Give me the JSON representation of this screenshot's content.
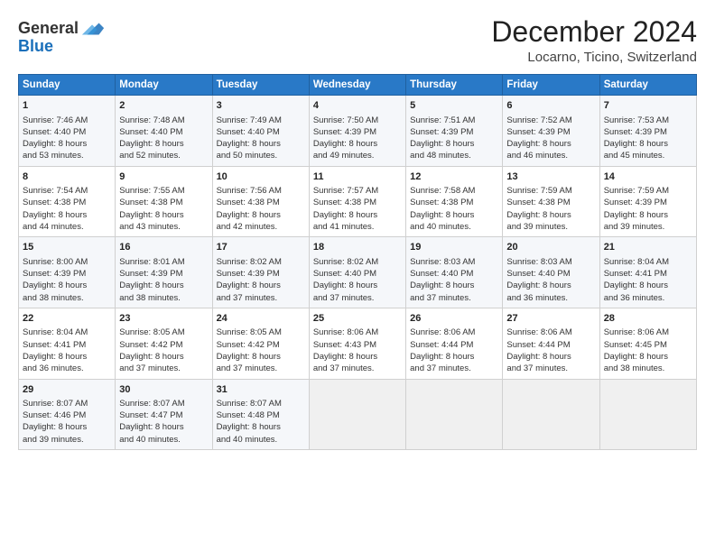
{
  "logo": {
    "line1": "General",
    "line2": "Blue"
  },
  "title": "December 2024",
  "location": "Locarno, Ticino, Switzerland",
  "days_of_week": [
    "Sunday",
    "Monday",
    "Tuesday",
    "Wednesday",
    "Thursday",
    "Friday",
    "Saturday"
  ],
  "weeks": [
    [
      {
        "day": "1",
        "lines": [
          "Sunrise: 7:46 AM",
          "Sunset: 4:40 PM",
          "Daylight: 8 hours",
          "and 53 minutes."
        ]
      },
      {
        "day": "2",
        "lines": [
          "Sunrise: 7:48 AM",
          "Sunset: 4:40 PM",
          "Daylight: 8 hours",
          "and 52 minutes."
        ]
      },
      {
        "day": "3",
        "lines": [
          "Sunrise: 7:49 AM",
          "Sunset: 4:40 PM",
          "Daylight: 8 hours",
          "and 50 minutes."
        ]
      },
      {
        "day": "4",
        "lines": [
          "Sunrise: 7:50 AM",
          "Sunset: 4:39 PM",
          "Daylight: 8 hours",
          "and 49 minutes."
        ]
      },
      {
        "day": "5",
        "lines": [
          "Sunrise: 7:51 AM",
          "Sunset: 4:39 PM",
          "Daylight: 8 hours",
          "and 48 minutes."
        ]
      },
      {
        "day": "6",
        "lines": [
          "Sunrise: 7:52 AM",
          "Sunset: 4:39 PM",
          "Daylight: 8 hours",
          "and 46 minutes."
        ]
      },
      {
        "day": "7",
        "lines": [
          "Sunrise: 7:53 AM",
          "Sunset: 4:39 PM",
          "Daylight: 8 hours",
          "and 45 minutes."
        ]
      }
    ],
    [
      {
        "day": "8",
        "lines": [
          "Sunrise: 7:54 AM",
          "Sunset: 4:38 PM",
          "Daylight: 8 hours",
          "and 44 minutes."
        ]
      },
      {
        "day": "9",
        "lines": [
          "Sunrise: 7:55 AM",
          "Sunset: 4:38 PM",
          "Daylight: 8 hours",
          "and 43 minutes."
        ]
      },
      {
        "day": "10",
        "lines": [
          "Sunrise: 7:56 AM",
          "Sunset: 4:38 PM",
          "Daylight: 8 hours",
          "and 42 minutes."
        ]
      },
      {
        "day": "11",
        "lines": [
          "Sunrise: 7:57 AM",
          "Sunset: 4:38 PM",
          "Daylight: 8 hours",
          "and 41 minutes."
        ]
      },
      {
        "day": "12",
        "lines": [
          "Sunrise: 7:58 AM",
          "Sunset: 4:38 PM",
          "Daylight: 8 hours",
          "and 40 minutes."
        ]
      },
      {
        "day": "13",
        "lines": [
          "Sunrise: 7:59 AM",
          "Sunset: 4:38 PM",
          "Daylight: 8 hours",
          "and 39 minutes."
        ]
      },
      {
        "day": "14",
        "lines": [
          "Sunrise: 7:59 AM",
          "Sunset: 4:39 PM",
          "Daylight: 8 hours",
          "and 39 minutes."
        ]
      }
    ],
    [
      {
        "day": "15",
        "lines": [
          "Sunrise: 8:00 AM",
          "Sunset: 4:39 PM",
          "Daylight: 8 hours",
          "and 38 minutes."
        ]
      },
      {
        "day": "16",
        "lines": [
          "Sunrise: 8:01 AM",
          "Sunset: 4:39 PM",
          "Daylight: 8 hours",
          "and 38 minutes."
        ]
      },
      {
        "day": "17",
        "lines": [
          "Sunrise: 8:02 AM",
          "Sunset: 4:39 PM",
          "Daylight: 8 hours",
          "and 37 minutes."
        ]
      },
      {
        "day": "18",
        "lines": [
          "Sunrise: 8:02 AM",
          "Sunset: 4:40 PM",
          "Daylight: 8 hours",
          "and 37 minutes."
        ]
      },
      {
        "day": "19",
        "lines": [
          "Sunrise: 8:03 AM",
          "Sunset: 4:40 PM",
          "Daylight: 8 hours",
          "and 37 minutes."
        ]
      },
      {
        "day": "20",
        "lines": [
          "Sunrise: 8:03 AM",
          "Sunset: 4:40 PM",
          "Daylight: 8 hours",
          "and 36 minutes."
        ]
      },
      {
        "day": "21",
        "lines": [
          "Sunrise: 8:04 AM",
          "Sunset: 4:41 PM",
          "Daylight: 8 hours",
          "and 36 minutes."
        ]
      }
    ],
    [
      {
        "day": "22",
        "lines": [
          "Sunrise: 8:04 AM",
          "Sunset: 4:41 PM",
          "Daylight: 8 hours",
          "and 36 minutes."
        ]
      },
      {
        "day": "23",
        "lines": [
          "Sunrise: 8:05 AM",
          "Sunset: 4:42 PM",
          "Daylight: 8 hours",
          "and 37 minutes."
        ]
      },
      {
        "day": "24",
        "lines": [
          "Sunrise: 8:05 AM",
          "Sunset: 4:42 PM",
          "Daylight: 8 hours",
          "and 37 minutes."
        ]
      },
      {
        "day": "25",
        "lines": [
          "Sunrise: 8:06 AM",
          "Sunset: 4:43 PM",
          "Daylight: 8 hours",
          "and 37 minutes."
        ]
      },
      {
        "day": "26",
        "lines": [
          "Sunrise: 8:06 AM",
          "Sunset: 4:44 PM",
          "Daylight: 8 hours",
          "and 37 minutes."
        ]
      },
      {
        "day": "27",
        "lines": [
          "Sunrise: 8:06 AM",
          "Sunset: 4:44 PM",
          "Daylight: 8 hours",
          "and 37 minutes."
        ]
      },
      {
        "day": "28",
        "lines": [
          "Sunrise: 8:06 AM",
          "Sunset: 4:45 PM",
          "Daylight: 8 hours",
          "and 38 minutes."
        ]
      }
    ],
    [
      {
        "day": "29",
        "lines": [
          "Sunrise: 8:07 AM",
          "Sunset: 4:46 PM",
          "Daylight: 8 hours",
          "and 39 minutes."
        ]
      },
      {
        "day": "30",
        "lines": [
          "Sunrise: 8:07 AM",
          "Sunset: 4:47 PM",
          "Daylight: 8 hours",
          "and 40 minutes."
        ]
      },
      {
        "day": "31",
        "lines": [
          "Sunrise: 8:07 AM",
          "Sunset: 4:48 PM",
          "Daylight: 8 hours",
          "and 40 minutes."
        ]
      },
      null,
      null,
      null,
      null
    ]
  ]
}
